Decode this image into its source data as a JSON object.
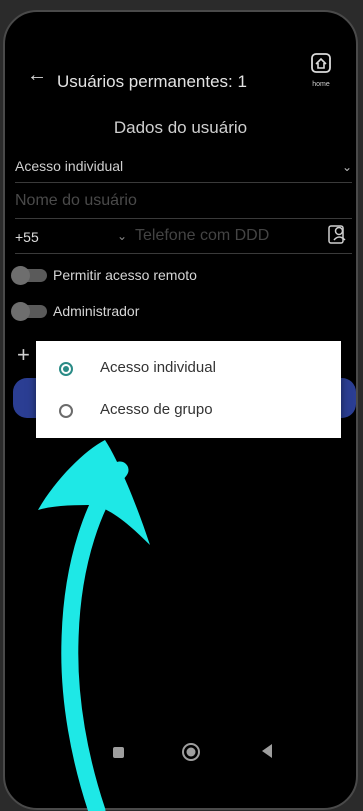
{
  "header": {
    "back_icon": "arrow-left-icon",
    "title": "Usuários permanentes: 1",
    "home_label": "home"
  },
  "form": {
    "section_title": "Dados do usuário",
    "access_type_value": "Acesso individual",
    "name_placeholder": "Nome do usuário",
    "country_code": "+55",
    "phone_placeholder": "Telefone com DDD",
    "remote_access_label": "Permitir acesso remoto",
    "admin_label": "Administrador",
    "plus_symbol": "+"
  },
  "dialog": {
    "options": [
      {
        "label": "Acesso individual",
        "selected": true
      },
      {
        "label": "Acesso de grupo",
        "selected": false
      }
    ]
  },
  "colors": {
    "accent": "#2a8b86",
    "button": "#2b3e93",
    "annotation_arrow": "#1ee8e6"
  }
}
